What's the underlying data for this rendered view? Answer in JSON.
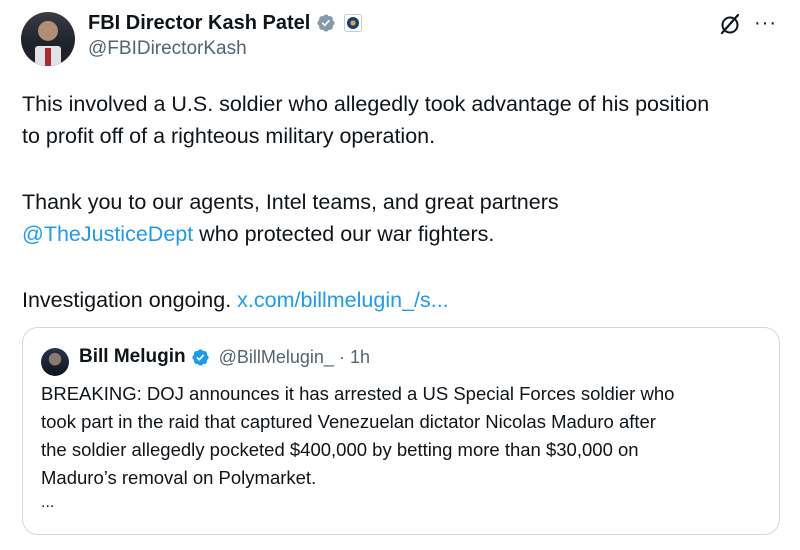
{
  "author": {
    "display_name": "FBI Director Kash Patel",
    "handle": "@FBIDirectorKash",
    "verified_icon": "verified-badge-icon",
    "affiliation_icon": "fbi-seal-icon"
  },
  "actions": {
    "grok_icon": "grok-icon",
    "more_label": "···"
  },
  "tweet": {
    "line1": "This involved a U.S. soldier who allegedly took advantage of his position",
    "line2": "to profit off of a righteous military operation.",
    "line3": "Thank you to our agents, Intel teams, and great partners",
    "mention": "@TheJusticeDept",
    "line4_rest": " who protected our war fighters.",
    "line5_prefix": "Investigation ongoing. ",
    "link": "x.com/billmelugin_/s..."
  },
  "quoted": {
    "display_name": "Bill Melugin",
    "handle": "@BillMelugin_",
    "separator": "·",
    "time": "1h",
    "lines": [
      "BREAKING: DOJ announces it has arrested a US Special Forces soldier who",
      "took part in the raid that captured Venezuelan dictator Nicolas Maduro after",
      "the soldier allegedly pocketed $400,000 by betting more than $30,000 on",
      "Maduro’s removal on Polymarket."
    ],
    "ellipsis": "..."
  },
  "colors": {
    "link": "#1d9bf0",
    "verified": "#829aab",
    "secondary_text": "#536471",
    "border": "#cfd9de"
  }
}
